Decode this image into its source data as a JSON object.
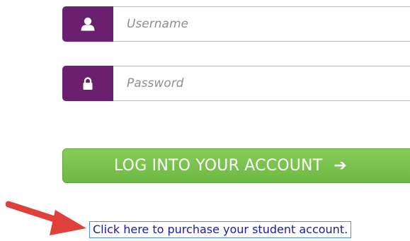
{
  "login_form": {
    "username": {
      "placeholder": "Username",
      "icon": "user-icon"
    },
    "password": {
      "placeholder": "Password",
      "icon": "lock-icon"
    },
    "submit_label": "LOG INTO YOUR ACCOUNT",
    "submit_arrow": "➔"
  },
  "purchase_link": {
    "label": "Click here to purchase your student account."
  },
  "annotation": {
    "icon": "red-arrow-icon"
  },
  "colors": {
    "icon_box": "#6b1f6f",
    "button_green": "#78c14f",
    "link_blue": "#1a1aa8",
    "focus_border": "#4a8fe0",
    "annotation_red": "#e0403a"
  }
}
